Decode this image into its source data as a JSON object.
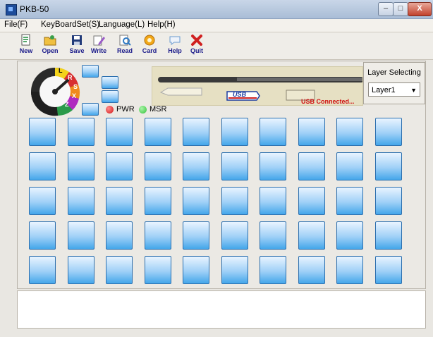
{
  "window": {
    "title": "PKB-50"
  },
  "menu": [
    {
      "label": "File(F)"
    },
    {
      "label": "KeyBoardSet(S)"
    },
    {
      "label": "Language(L)"
    },
    {
      "label": "Help(H)"
    }
  ],
  "toolbar": [
    {
      "label": "New",
      "icon": "new-file-icon",
      "color": "#1d8a3a"
    },
    {
      "label": "Open",
      "icon": "open-folder-icon",
      "color": "#d89c20"
    },
    {
      "label": "Save",
      "icon": "save-disk-icon",
      "color": "#223b7a"
    },
    {
      "label": "Write",
      "icon": "write-pencil-icon",
      "color": "#9a5bc7"
    },
    {
      "label": "Read",
      "icon": "read-magnifier-icon",
      "color": "#2f7ac4"
    },
    {
      "label": "Card",
      "icon": "card-gear-icon",
      "color": "#e08a10"
    },
    {
      "label": "Help",
      "icon": "help-bubble-icon",
      "color": "#6a9ad0"
    },
    {
      "label": "Quit",
      "icon": "quit-cross-icon",
      "color": "#d02020"
    }
  ],
  "dial": {
    "positions": [
      "L",
      "R",
      "S",
      "X",
      "Z"
    ]
  },
  "indicators": [
    {
      "label": "PWR",
      "color": "#d21a1a"
    },
    {
      "label": "MSR",
      "color": "#34c23a"
    }
  ],
  "status": {
    "usb_logo": "USB",
    "usb_text": "USB Connected..."
  },
  "layer": {
    "title": "Layer Selecting",
    "selected": "Layer1"
  },
  "keys": {
    "rows": 5,
    "cols": 10
  },
  "colors": {
    "key_blue": "#44a6ea",
    "status_red": "#d01010"
  }
}
